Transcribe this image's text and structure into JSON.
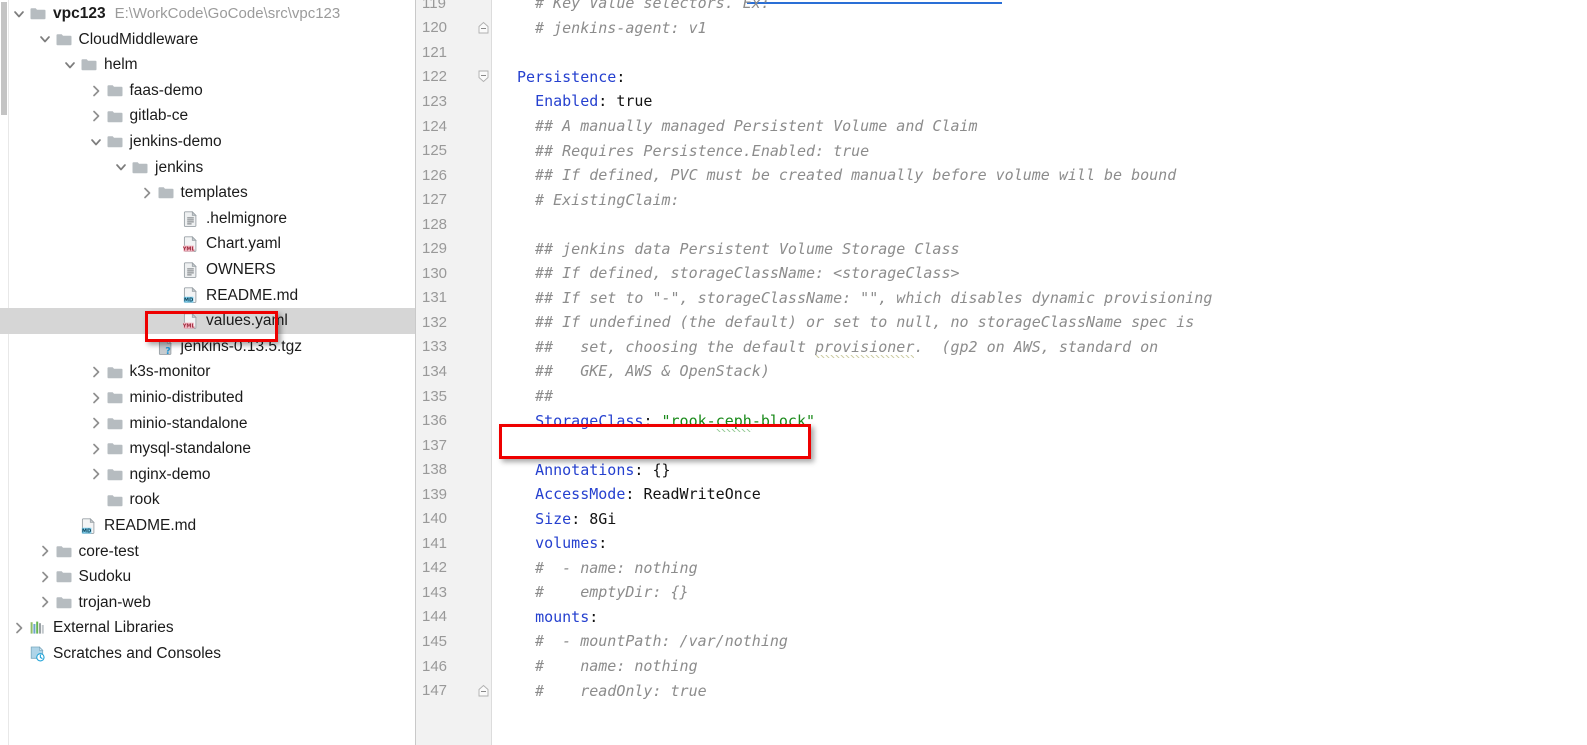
{
  "window": {
    "app": "jetbrains-ide",
    "accent_key_color": "#2540cf",
    "accent_string_color": "#1a8a1a",
    "annotation_color": "#ee0000",
    "selection_color": "#d6d6d6",
    "gutter_color": "#f2f2f2"
  },
  "sidebar": {
    "name": "project-tree",
    "items": [
      {
        "label": "vpc123",
        "path": "E:\\WorkCode\\GoCode\\src\\vpc123",
        "indent": 0,
        "twisty": "down",
        "icon": "folder-icon",
        "bold": true,
        "selected": false
      },
      {
        "label": "CloudMiddleware",
        "path": "",
        "indent": 1,
        "twisty": "down",
        "icon": "folder-icon",
        "bold": false,
        "selected": false
      },
      {
        "label": "helm",
        "path": "",
        "indent": 2,
        "twisty": "down",
        "icon": "folder-icon",
        "bold": false,
        "selected": false
      },
      {
        "label": "faas-demo",
        "path": "",
        "indent": 3,
        "twisty": "right",
        "icon": "folder-icon",
        "bold": false,
        "selected": false
      },
      {
        "label": "gitlab-ce",
        "path": "",
        "indent": 3,
        "twisty": "right",
        "icon": "folder-icon",
        "bold": false,
        "selected": false
      },
      {
        "label": "jenkins-demo",
        "path": "",
        "indent": 3,
        "twisty": "down",
        "icon": "folder-icon",
        "bold": false,
        "selected": false
      },
      {
        "label": "jenkins",
        "path": "",
        "indent": 4,
        "twisty": "down",
        "icon": "folder-icon",
        "bold": false,
        "selected": false
      },
      {
        "label": "templates",
        "path": "",
        "indent": 5,
        "twisty": "right",
        "icon": "folder-icon",
        "bold": false,
        "selected": false
      },
      {
        "label": ".helmignore",
        "path": "",
        "indent": 6,
        "twisty": "none",
        "icon": "text-file-icon",
        "bold": false,
        "selected": false
      },
      {
        "label": "Chart.yaml",
        "path": "",
        "indent": 6,
        "twisty": "none",
        "icon": "yaml-file-icon",
        "bold": false,
        "selected": false
      },
      {
        "label": "OWNERS",
        "path": "",
        "indent": 6,
        "twisty": "none",
        "icon": "text-file-icon",
        "bold": false,
        "selected": false
      },
      {
        "label": "README.md",
        "path": "",
        "indent": 6,
        "twisty": "none",
        "icon": "markdown-file-icon",
        "bold": false,
        "selected": false
      },
      {
        "label": "values.yaml",
        "path": "",
        "indent": 6,
        "twisty": "none",
        "icon": "yaml-file-icon",
        "bold": false,
        "selected": true
      },
      {
        "label": "jenkins-0.13.5.tgz",
        "path": "",
        "indent": 5,
        "twisty": "none",
        "icon": "archive-file-icon",
        "bold": false,
        "selected": false
      },
      {
        "label": "k3s-monitor",
        "path": "",
        "indent": 3,
        "twisty": "right",
        "icon": "folder-icon",
        "bold": false,
        "selected": false
      },
      {
        "label": "minio-distributed",
        "path": "",
        "indent": 3,
        "twisty": "right",
        "icon": "folder-icon",
        "bold": false,
        "selected": false
      },
      {
        "label": "minio-standalone",
        "path": "",
        "indent": 3,
        "twisty": "right",
        "icon": "folder-icon",
        "bold": false,
        "selected": false
      },
      {
        "label": "mysql-standalone",
        "path": "",
        "indent": 3,
        "twisty": "right",
        "icon": "folder-icon",
        "bold": false,
        "selected": false
      },
      {
        "label": "nginx-demo",
        "path": "",
        "indent": 3,
        "twisty": "right",
        "icon": "folder-icon",
        "bold": false,
        "selected": false
      },
      {
        "label": "rook",
        "path": "",
        "indent": 3,
        "twisty": "none",
        "icon": "folder-icon",
        "bold": false,
        "selected": false
      },
      {
        "label": "README.md",
        "path": "",
        "indent": 2,
        "twisty": "none",
        "icon": "markdown-file-icon",
        "bold": false,
        "selected": false
      },
      {
        "label": "core-test",
        "path": "",
        "indent": 1,
        "twisty": "right",
        "icon": "folder-icon",
        "bold": false,
        "selected": false
      },
      {
        "label": "Sudoku",
        "path": "",
        "indent": 1,
        "twisty": "right",
        "icon": "folder-icon",
        "bold": false,
        "selected": false
      },
      {
        "label": "trojan-web",
        "path": "",
        "indent": 1,
        "twisty": "right",
        "icon": "folder-icon",
        "bold": false,
        "selected": false
      },
      {
        "label": "External Libraries",
        "path": "",
        "indent": 0,
        "twisty": "right",
        "icon": "libraries-icon",
        "bold": false,
        "selected": false
      },
      {
        "label": "Scratches and Consoles",
        "path": "",
        "indent": 0,
        "twisty": "none",
        "icon": "scratches-icon",
        "bold": false,
        "selected": false
      }
    ]
  },
  "editor": {
    "name": "values-yaml-editor",
    "first_line": 119,
    "last_line": 147,
    "lines": [
      {
        "no": "119",
        "fold": "none",
        "segments": [
          {
            "t": "  # Key Value selectors. Ex:",
            "c": "cm"
          }
        ]
      },
      {
        "no": "120",
        "fold": "end",
        "segments": [
          {
            "t": "  # jenkins-agent: v1",
            "c": "cm"
          }
        ]
      },
      {
        "no": "121",
        "fold": "none",
        "segments": [
          {
            "t": "",
            "c": "val"
          }
        ]
      },
      {
        "no": "122",
        "fold": "start",
        "segments": [
          {
            "t": "Persistence",
            "c": "key"
          },
          {
            "t": ":",
            "c": "val"
          }
        ]
      },
      {
        "no": "123",
        "fold": "none",
        "segments": [
          {
            "t": "  ",
            "c": "val"
          },
          {
            "t": "Enabled",
            "c": "key"
          },
          {
            "t": ": ",
            "c": "val"
          },
          {
            "t": "true",
            "c": "val"
          }
        ]
      },
      {
        "no": "124",
        "fold": "none",
        "segments": [
          {
            "t": "  ## A manually managed Persistent Volume and Claim",
            "c": "cm"
          }
        ]
      },
      {
        "no": "125",
        "fold": "none",
        "segments": [
          {
            "t": "  ## Requires Persistence.Enabled: true",
            "c": "cm"
          }
        ]
      },
      {
        "no": "126",
        "fold": "none",
        "segments": [
          {
            "t": "  ## If defined, PVC must be created manually before volume will be bound",
            "c": "cm"
          }
        ]
      },
      {
        "no": "127",
        "fold": "none",
        "segments": [
          {
            "t": "  # ExistingClaim:",
            "c": "cm"
          }
        ]
      },
      {
        "no": "128",
        "fold": "none",
        "segments": [
          {
            "t": "",
            "c": "val"
          }
        ]
      },
      {
        "no": "129",
        "fold": "none",
        "segments": [
          {
            "t": "  ## jenkins data Persistent Volume Storage Class",
            "c": "cm"
          }
        ]
      },
      {
        "no": "130",
        "fold": "none",
        "segments": [
          {
            "t": "  ## If defined, storageClassName: <storageClass>",
            "c": "cm"
          }
        ]
      },
      {
        "no": "131",
        "fold": "none",
        "segments": [
          {
            "t": "  ## If set to \"-\", storageClassName: \"\", which disables dynamic provisioning",
            "c": "cm"
          }
        ]
      },
      {
        "no": "132",
        "fold": "none",
        "segments": [
          {
            "t": "  ## If undefined (the default) or set to null, no storageClassName spec is",
            "c": "cm"
          }
        ]
      },
      {
        "no": "133",
        "fold": "none",
        "segments": [
          {
            "t": "  ##   set, choosing the default ",
            "c": "cm"
          },
          {
            "t": "provisioner",
            "c": "cm squig squig-gray"
          },
          {
            "t": ".  (gp2 on AWS, standard on",
            "c": "cm"
          }
        ]
      },
      {
        "no": "134",
        "fold": "none",
        "segments": [
          {
            "t": "  ##   GKE, AWS & OpenStack)",
            "c": "cm"
          }
        ]
      },
      {
        "no": "135",
        "fold": "none",
        "segments": [
          {
            "t": "  ##",
            "c": "cm"
          }
        ]
      },
      {
        "no": "136",
        "fold": "none",
        "segments": [
          {
            "t": "  ",
            "c": "val"
          },
          {
            "t": "StorageClass",
            "c": "key"
          },
          {
            "t": ": ",
            "c": "val"
          },
          {
            "t": "\"rook-",
            "c": "str"
          },
          {
            "t": "ceph",
            "c": "str squig"
          },
          {
            "t": "-block\"",
            "c": "str"
          }
        ]
      },
      {
        "no": "137",
        "fold": "none",
        "segments": [
          {
            "t": "",
            "c": "val"
          }
        ]
      },
      {
        "no": "138",
        "fold": "none",
        "segments": [
          {
            "t": "  ",
            "c": "val"
          },
          {
            "t": "Annotations",
            "c": "key"
          },
          {
            "t": ": ",
            "c": "val"
          },
          {
            "t": "{}",
            "c": "val"
          }
        ]
      },
      {
        "no": "139",
        "fold": "none",
        "segments": [
          {
            "t": "  ",
            "c": "val"
          },
          {
            "t": "AccessMode",
            "c": "key"
          },
          {
            "t": ": ",
            "c": "val"
          },
          {
            "t": "ReadWriteOnce",
            "c": "val"
          }
        ]
      },
      {
        "no": "140",
        "fold": "none",
        "segments": [
          {
            "t": "  ",
            "c": "val"
          },
          {
            "t": "Size",
            "c": "key"
          },
          {
            "t": ": ",
            "c": "val"
          },
          {
            "t": "8Gi",
            "c": "val"
          }
        ]
      },
      {
        "no": "141",
        "fold": "none",
        "segments": [
          {
            "t": "  ",
            "c": "val"
          },
          {
            "t": "volumes",
            "c": "key"
          },
          {
            "t": ":",
            "c": "val"
          }
        ]
      },
      {
        "no": "142",
        "fold": "none",
        "segments": [
          {
            "t": "  #  - name: nothing",
            "c": "cm"
          }
        ]
      },
      {
        "no": "143",
        "fold": "none",
        "segments": [
          {
            "t": "  #    emptyDir: {}",
            "c": "cm"
          }
        ]
      },
      {
        "no": "144",
        "fold": "none",
        "segments": [
          {
            "t": "  ",
            "c": "val"
          },
          {
            "t": "mounts",
            "c": "key"
          },
          {
            "t": ":",
            "c": "val"
          }
        ]
      },
      {
        "no": "145",
        "fold": "none",
        "segments": [
          {
            "t": "  #  - mountPath: /var/nothing",
            "c": "cm"
          }
        ]
      },
      {
        "no": "146",
        "fold": "none",
        "segments": [
          {
            "t": "  #    name: nothing",
            "c": "cm"
          }
        ]
      },
      {
        "no": "147",
        "fold": "end",
        "segments": [
          {
            "t": "  #    readOnly: true",
            "c": "cm"
          }
        ]
      }
    ]
  },
  "annotations": [
    {
      "name": "annot-values-yaml",
      "target": "values.yaml"
    },
    {
      "name": "annot-storageclass",
      "target": "StorageClass: \"rook-ceph-block\""
    }
  ]
}
